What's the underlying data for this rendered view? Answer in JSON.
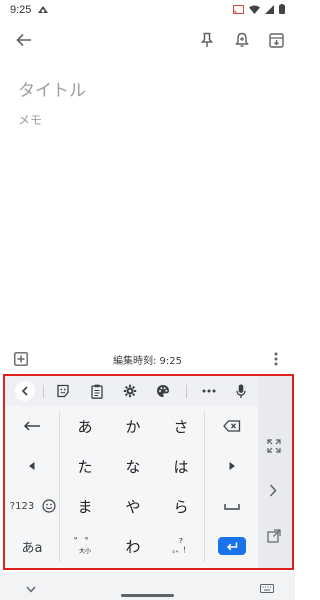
{
  "status_bar": {
    "time": "9:25"
  },
  "note": {
    "title_placeholder": "タイトル",
    "body_placeholder": "メモ"
  },
  "note_bar": {
    "edit_time": "編集時刻: 9:25"
  },
  "keyboard": {
    "keys": {
      "a": "あ",
      "ka": "か",
      "sa": "さ",
      "ta": "た",
      "na": "な",
      "ha": "は",
      "ma": "ま",
      "ya": "や",
      "ra": "ら",
      "wa": "わ",
      "numeric_mode": "?123",
      "kana_mode": "あa",
      "dakuten_main": "゛゜",
      "dakuten_sub": "大小",
      "punct_top": "?",
      "punct_bottom": "。、！"
    }
  },
  "colors": {
    "accent": "#1a73e8",
    "highlight_border": "#e02020"
  },
  "icons": {
    "back": "arrow-left-icon",
    "pin": "pin-icon",
    "reminder": "bell-plus-icon",
    "archive": "archive-icon",
    "add": "add-box-icon",
    "more": "more-vert-icon"
  }
}
